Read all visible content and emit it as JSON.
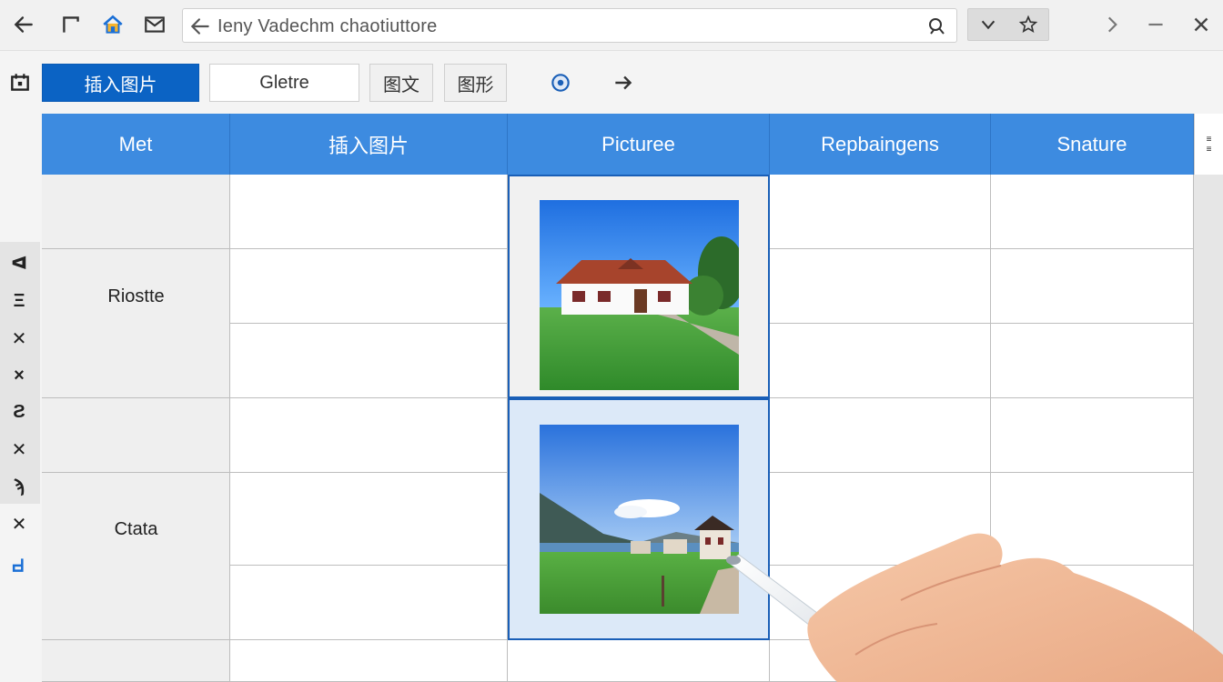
{
  "address_bar": {
    "text": "Ieny Vadechm chaotiuttore",
    "placeholder": ""
  },
  "toolbar": {
    "insert_image_label": "插入图片",
    "field_value": "Gletre",
    "text_button_label": "图文",
    "shape_button_label": "图形"
  },
  "table": {
    "headers": [
      "Met",
      "插入图片",
      "Picturee",
      "Repbaingens",
      "Snature"
    ],
    "row_labels": [
      "Riostte",
      "Ctata"
    ]
  },
  "left_rail": {
    "items": [
      "ᐊ",
      "Ξ",
      "✕",
      "×",
      "Ƨ",
      "✕",
      "ϡ",
      "✕"
    ]
  },
  "right_strip": {
    "lines": [
      "≡",
      "≡"
    ]
  },
  "colors": {
    "accent_blue": "#0b63c4",
    "header_blue": "#3d8be0",
    "selection_border": "#1a5fb7"
  },
  "icons": {
    "back": "back-arrow-icon",
    "window": "window-corner-icon",
    "home": "home-icon",
    "mail": "mail-icon",
    "search": "search-icon",
    "chevron_down": "chevron-down-icon",
    "star": "star-icon",
    "chevron_right": "chevron-right-icon",
    "minimize": "minimize-icon",
    "close": "close-icon",
    "calendar": "calendar-icon",
    "record": "record-icon",
    "forward": "forward-arrow-icon"
  }
}
